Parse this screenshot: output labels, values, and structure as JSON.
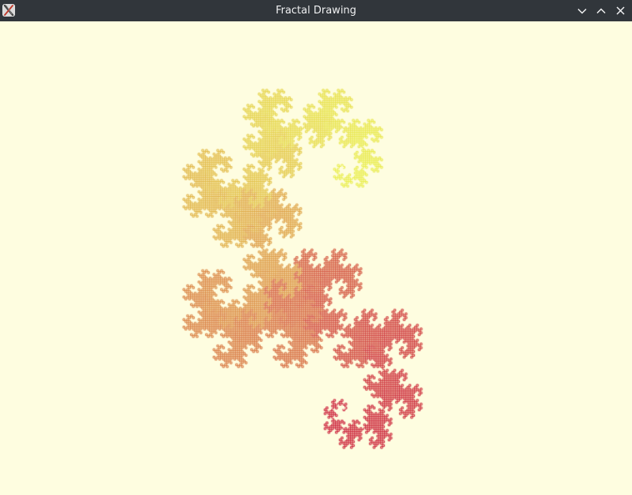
{
  "window": {
    "title": "Fractal Drawing",
    "background_color": "#fefde0",
    "titlebar_color": "#31363b",
    "app_icon": "x-app-icon",
    "controls": {
      "minimize_icon": "chevron-down-icon",
      "maximize_icon": "chevron-up-icon",
      "close_icon": "close-icon"
    }
  },
  "fractal": {
    "type": "dragon-curve",
    "color_start": "#c8102e",
    "color_end": "#e8f040"
  }
}
